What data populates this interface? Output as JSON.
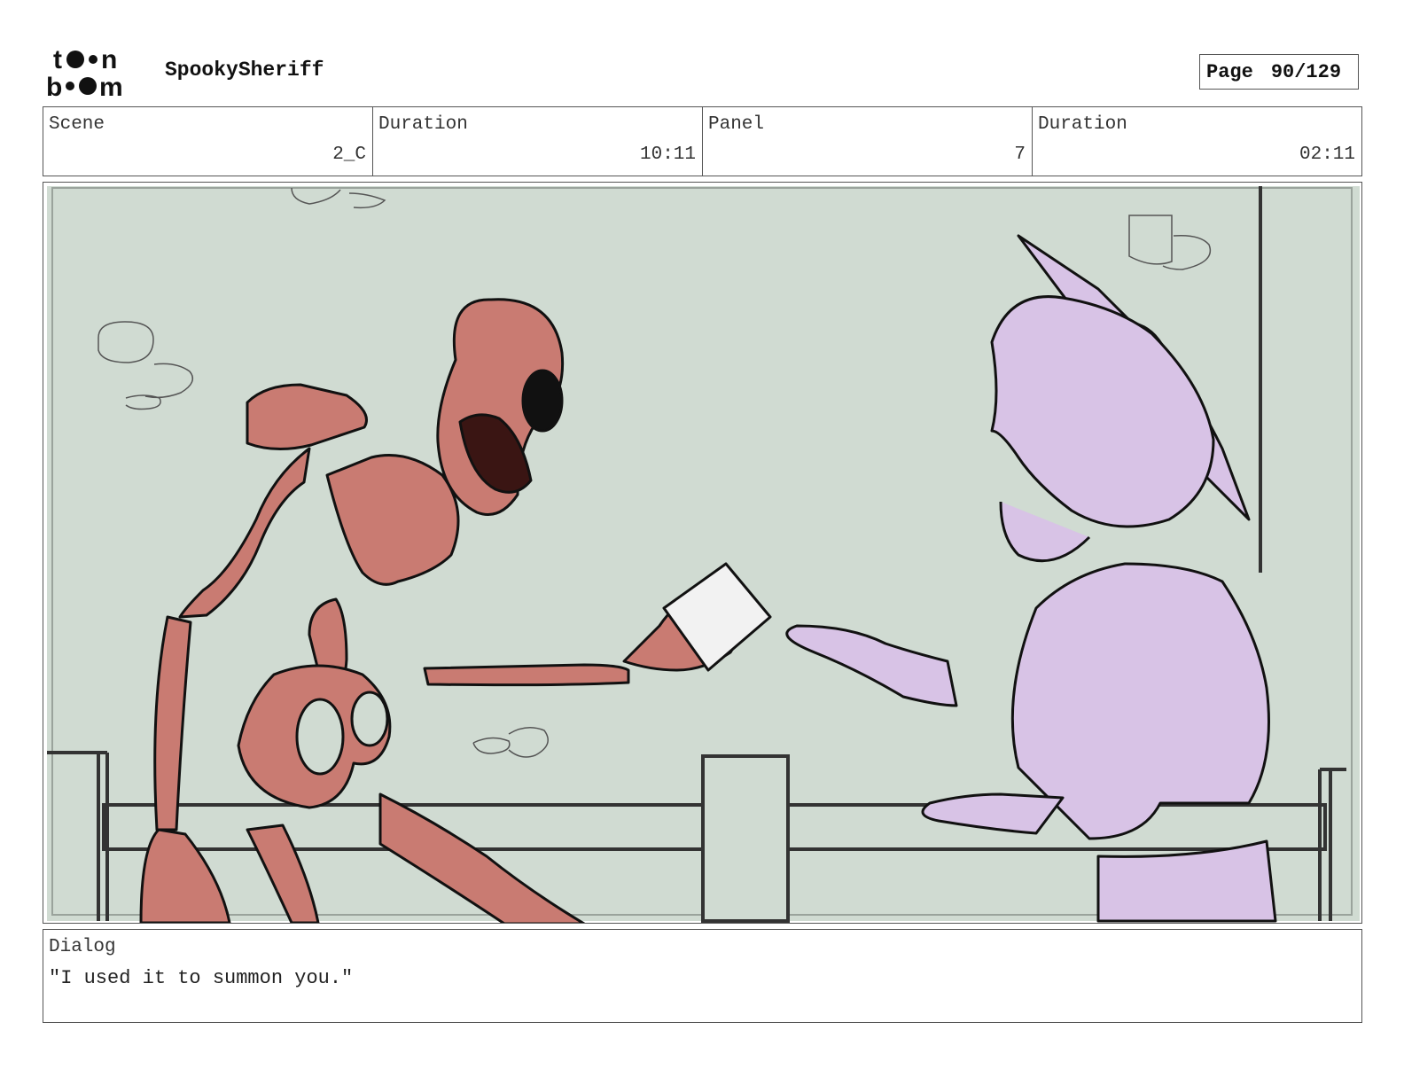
{
  "header": {
    "logo_text": "toon boom",
    "project_title": "SpookySheriff",
    "page_label": "Page",
    "page_value": "90/129"
  },
  "info": {
    "scene_label": "Scene",
    "scene_value": "2_C",
    "scene_duration_label": "Duration",
    "scene_duration_value": "10:11",
    "panel_label": "Panel",
    "panel_value": "7",
    "panel_duration_label": "Duration",
    "panel_duration_value": "02:11"
  },
  "panel_image": {
    "background_color": "#d0dbd2",
    "skeleton_color": "#c97b72",
    "ghost_color": "#d8c3e6"
  },
  "dialog": {
    "label": "Dialog",
    "text": "\"I used it to summon you.\""
  }
}
